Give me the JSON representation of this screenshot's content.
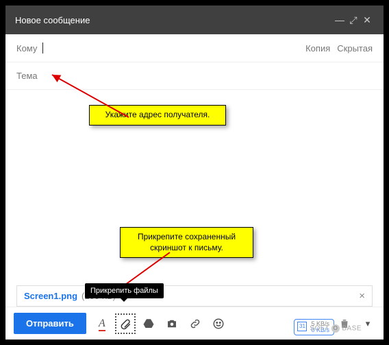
{
  "titlebar": {
    "title": "Новое сообщение"
  },
  "recipients": {
    "to_label": "Кому",
    "to_value": "",
    "cc": "Копия",
    "bcc": "Скрытая"
  },
  "subject": {
    "placeholder": "Тема"
  },
  "callouts": {
    "c1": "Укажите адрес получателя.",
    "c2": "Прикрепите сохраненный скриншот к письму."
  },
  "attachment": {
    "name": "Screen1.png",
    "size": "(200 КБ)"
  },
  "tooltip": {
    "attach": "Прикрепить файлы"
  },
  "toolbar": {
    "send": "Отправить"
  },
  "net": {
    "up": "5 KB/s",
    "down": "0 KB/s",
    "num": "31"
  },
  "watermark": {
    "a": "SOFT",
    "b": "BASE"
  }
}
